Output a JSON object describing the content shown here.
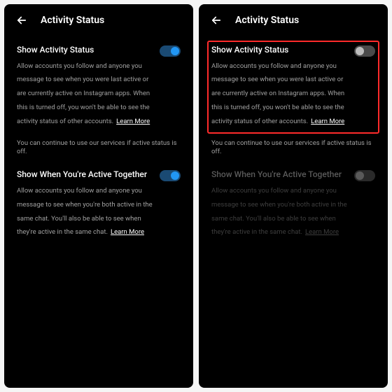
{
  "header_title": "Activity Status",
  "section1": {
    "title": "Show Activity Status",
    "desc": "Allow accounts you follow and anyone you message to see when you were last active or are currently active on Instagram apps. When this is turned off, you won't be able to see the activity status of other accounts.",
    "learn": "Learn More"
  },
  "note": "You can continue to use our services if active status is off.",
  "section2": {
    "title": "Show When You're Active Together",
    "desc": "Allow accounts you follow and anyone you message to see when you're both active in the same chat. You'll also be able to see when they're active in the same chat.",
    "learn": "Learn More"
  },
  "left": {
    "toggle1": "on",
    "toggle2": "on"
  },
  "right": {
    "toggle1": "off",
    "toggle2": "off-disabled"
  }
}
